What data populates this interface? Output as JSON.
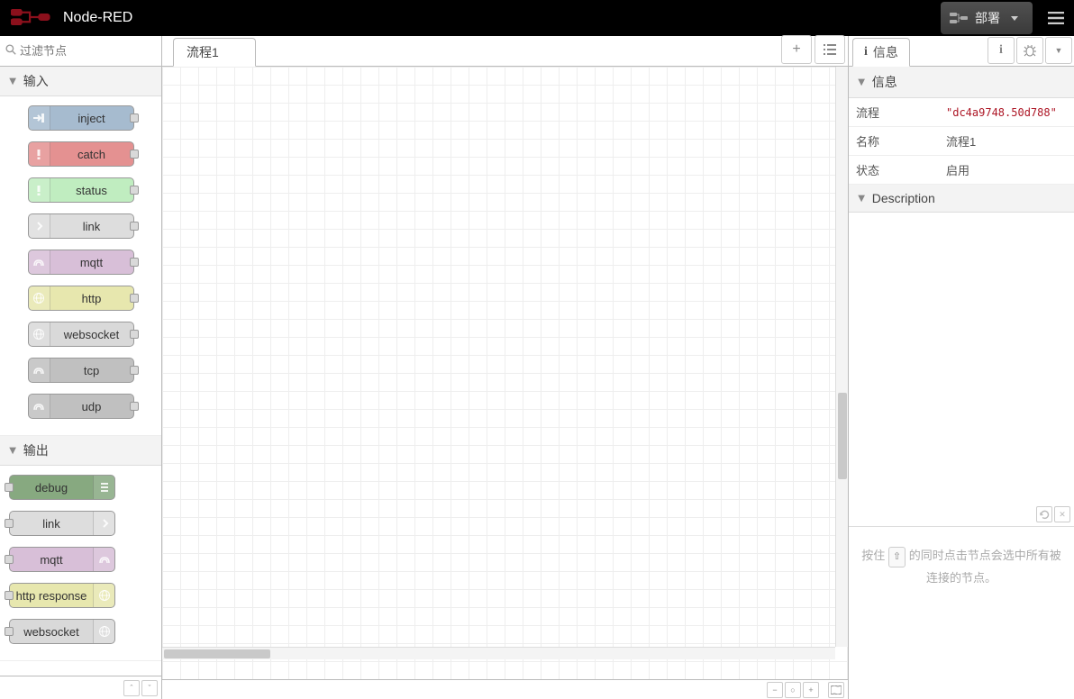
{
  "header": {
    "title": "Node-RED",
    "deploy_label": "部署"
  },
  "palette": {
    "search_placeholder": "过滤节点",
    "cat_input": "输入",
    "cat_output": "输出",
    "inputs": [
      {
        "label": "inject",
        "color": "c-inject",
        "icon": "arrow-in"
      },
      {
        "label": "catch",
        "color": "c-catch",
        "icon": "alert"
      },
      {
        "label": "status",
        "color": "c-status",
        "icon": "alert"
      },
      {
        "label": "link",
        "color": "c-link",
        "icon": "link"
      },
      {
        "label": "mqtt",
        "color": "c-mqtt",
        "icon": "bridge"
      },
      {
        "label": "http",
        "color": "c-http",
        "icon": "globe"
      },
      {
        "label": "websocket",
        "color": "c-ws",
        "icon": "globe"
      },
      {
        "label": "tcp",
        "color": "c-tcp",
        "icon": "bridge"
      },
      {
        "label": "udp",
        "color": "c-udp",
        "icon": "bridge"
      }
    ],
    "outputs": [
      {
        "label": "debug",
        "color": "c-debug",
        "icon": "debug"
      },
      {
        "label": "link",
        "color": "c-link",
        "icon": "link"
      },
      {
        "label": "mqtt",
        "color": "c-mqtt",
        "icon": "bridge"
      },
      {
        "label": "http response",
        "color": "c-httpres",
        "icon": "globe"
      },
      {
        "label": "websocket",
        "color": "c-ws",
        "icon": "globe"
      }
    ]
  },
  "tabs": {
    "flow1": "流程1"
  },
  "sidebar": {
    "tab_info": "信息",
    "section_info": "信息",
    "section_desc": "Description",
    "row_flow": "流程",
    "row_flow_val": "\"dc4a9748.50d788\"",
    "row_name": "名称",
    "row_name_val": "流程1",
    "row_state": "状态",
    "row_state_val": "启用",
    "tip_part1": "按住 ",
    "tip_key": "⇧",
    "tip_part2": " 的同时点击节点会选中所有被连接的节点。"
  }
}
